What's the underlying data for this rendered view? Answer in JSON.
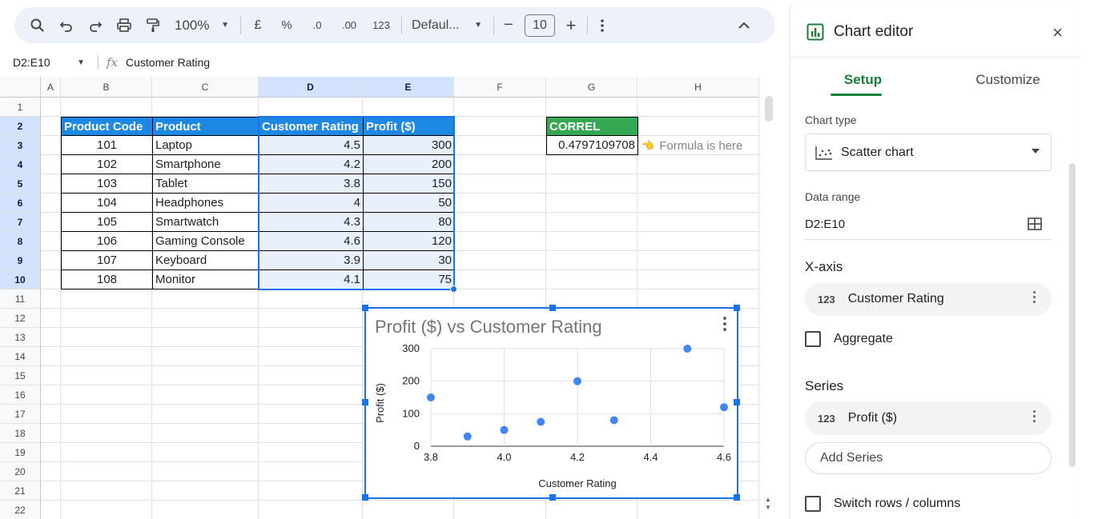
{
  "toolbar": {
    "zoom": "100%",
    "currency": "£",
    "percent": "%",
    "decrease_decimals": ".0",
    "increase_decimals": ".00",
    "number_format": "123",
    "font": "Defaul...",
    "minus": "−",
    "font_size": "10",
    "plus": "+"
  },
  "formula_bar": {
    "name_box": "D2:E10",
    "fx": "fx",
    "content": "Customer Rating"
  },
  "columns": [
    "A",
    "B",
    "C",
    "D",
    "E",
    "F",
    "G",
    "H"
  ],
  "rows": [
    "1",
    "2",
    "3",
    "4",
    "5",
    "6",
    "7",
    "8",
    "9",
    "10",
    "11",
    "12",
    "13",
    "14",
    "15",
    "16",
    "17",
    "18",
    "19",
    "20",
    "21",
    "22"
  ],
  "table": {
    "headers": [
      "Product Code",
      "Product",
      "Customer Rating",
      "Profit ($)"
    ],
    "rows": [
      [
        "101",
        "Laptop",
        "4.5",
        "300"
      ],
      [
        "102",
        "Smartphone",
        "4.2",
        "200"
      ],
      [
        "103",
        "Tablet",
        "3.8",
        "150"
      ],
      [
        "104",
        "Headphones",
        "4",
        "50"
      ],
      [
        "105",
        "Smartwatch",
        "4.3",
        "80"
      ],
      [
        "106",
        "Gaming Console",
        "4.6",
        "120"
      ],
      [
        "107",
        "Keyboard",
        "3.9",
        "30"
      ],
      [
        "108",
        "Monitor",
        "4.1",
        "75"
      ]
    ]
  },
  "correl": {
    "label": "CORREL",
    "value": "0.4797109708",
    "note_icon": "👈",
    "note": "Formula is here"
  },
  "chart_data": {
    "type": "scatter",
    "title": "Profit ($) vs Customer Rating",
    "xlabel": "Customer Rating",
    "ylabel": "Profit ($)",
    "xlim": [
      3.8,
      4.6
    ],
    "ylim": [
      0,
      300
    ],
    "xticks": [
      "3.8",
      "4.0",
      "4.2",
      "4.4",
      "4.6"
    ],
    "yticks": [
      "0",
      "100",
      "200",
      "300"
    ],
    "grid": true,
    "color": "#4285f4",
    "x": [
      4.5,
      4.2,
      3.8,
      4.0,
      4.3,
      4.6,
      3.9,
      4.1
    ],
    "y": [
      300,
      200,
      150,
      50,
      80,
      120,
      30,
      75
    ]
  },
  "panel": {
    "title": "Chart editor",
    "close": "×",
    "tabs": [
      "Setup",
      "Customize"
    ],
    "chart_type_label": "Chart type",
    "chart_type": "Scatter chart",
    "data_range_label": "Data range",
    "data_range": "D2:E10",
    "x_axis_label": "X-axis",
    "x_axis_value": "Customer Rating",
    "aggregate": "Aggregate",
    "series_label": "Series",
    "series_value": "Profit ($)",
    "add_series": "Add Series",
    "switch": "Switch rows / columns",
    "pill_icon": "123"
  }
}
